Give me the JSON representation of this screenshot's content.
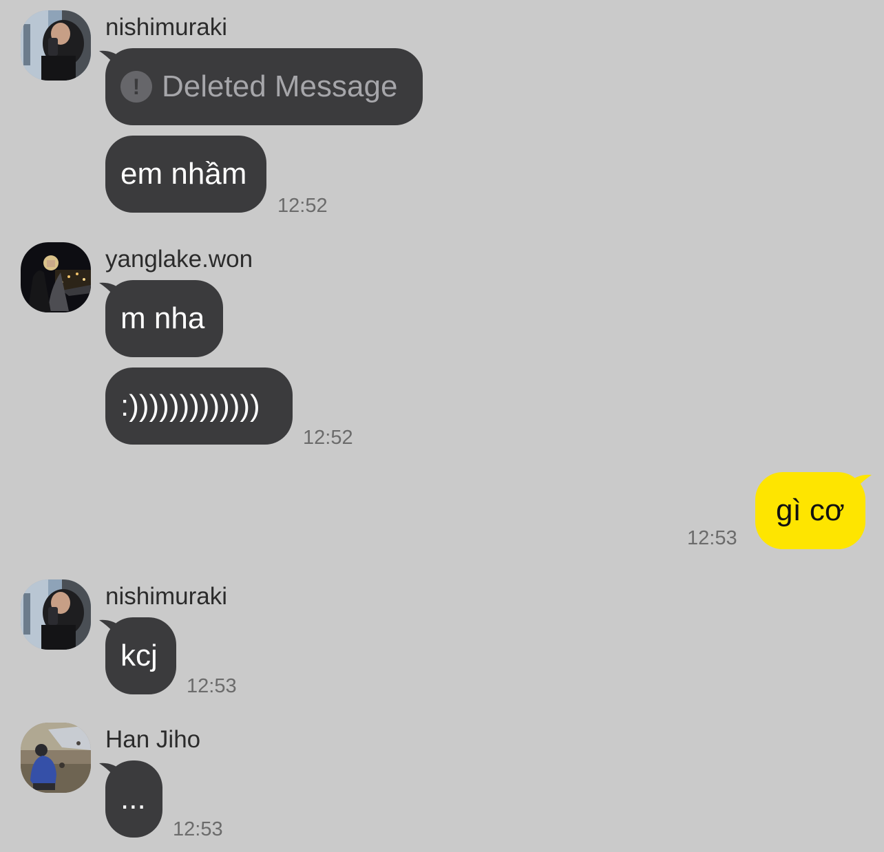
{
  "messages": [
    {
      "sender": "nishimuraki",
      "avatar": "avatar-nishimuraki",
      "bubbles": [
        {
          "deleted": true,
          "icon": "exclamation-icon",
          "text": "Deleted Message"
        },
        {
          "text": "em nhầm"
        }
      ],
      "time": "12:52"
    },
    {
      "sender": "yanglake.won",
      "avatar": "avatar-yanglake",
      "bubbles": [
        {
          "text": "m nha"
        },
        {
          "text": ":)))))))))))))"
        }
      ],
      "time": "12:52"
    },
    {
      "sender": "me",
      "bubbles": [
        {
          "text": "gì cơ"
        }
      ],
      "time": "12:53"
    },
    {
      "sender": "nishimuraki",
      "avatar": "avatar-nishimuraki",
      "bubbles": [
        {
          "text": "kcj"
        }
      ],
      "time": "12:53"
    },
    {
      "sender": "Han Jiho",
      "avatar": "avatar-hanjiho",
      "bubbles": [
        {
          "text": "..."
        }
      ],
      "time": "12:53"
    }
  ],
  "colors": {
    "background": "#cacaca",
    "received_bubble": "#3b3b3d",
    "sent_bubble": "#fee500"
  }
}
